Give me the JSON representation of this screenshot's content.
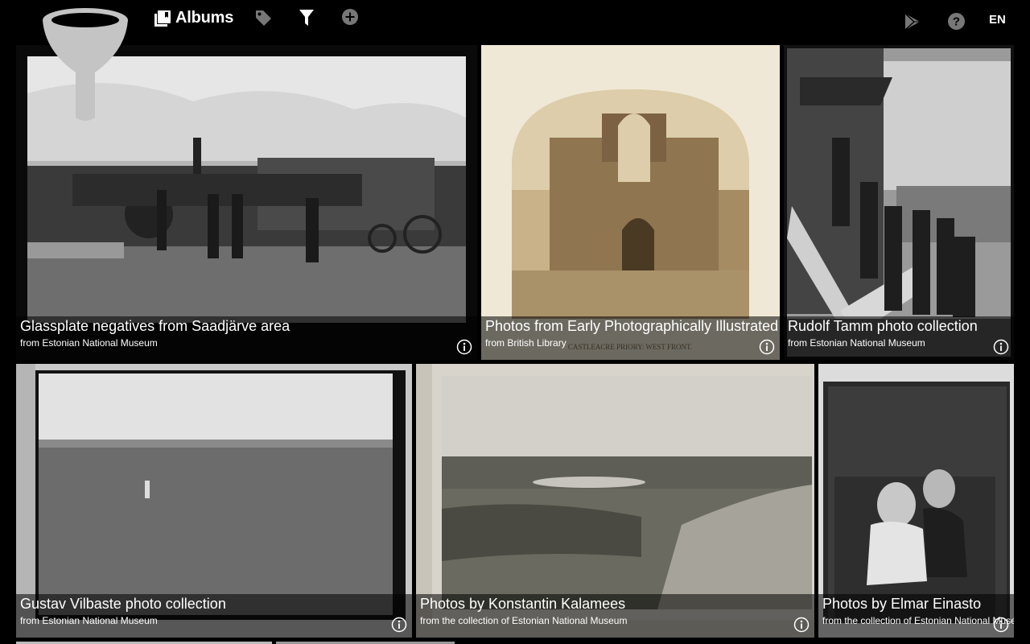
{
  "header": {
    "nav": {
      "albums_label": "Albums"
    },
    "language": "EN"
  },
  "albums": [
    {
      "title": "Glassplate negatives from Saadjärve area",
      "source": "from Estonian National Museum"
    },
    {
      "title": "Photos from Early Photographically Illustrated",
      "source": "from British Library"
    },
    {
      "title": "Rudolf Tamm photo collection",
      "source": "from Estonian National Museum"
    },
    {
      "title": "Gustav Vilbaste photo collection",
      "source": "from Estonian National Museum"
    },
    {
      "title": "Photos by Konstantin Kalamees",
      "source": "from the collection of Estonian National Museum"
    },
    {
      "title": "Photos by Elmar Einasto",
      "source": "from the collection of Estonian National Museum"
    }
  ],
  "icons": {
    "logo": "funnel-logo",
    "albums": "albums-icon",
    "tag": "tag-icon",
    "filter": "filter-icon",
    "add": "add-icon",
    "play_store": "play-store-icon",
    "help": "help-icon",
    "info": "info-icon"
  }
}
